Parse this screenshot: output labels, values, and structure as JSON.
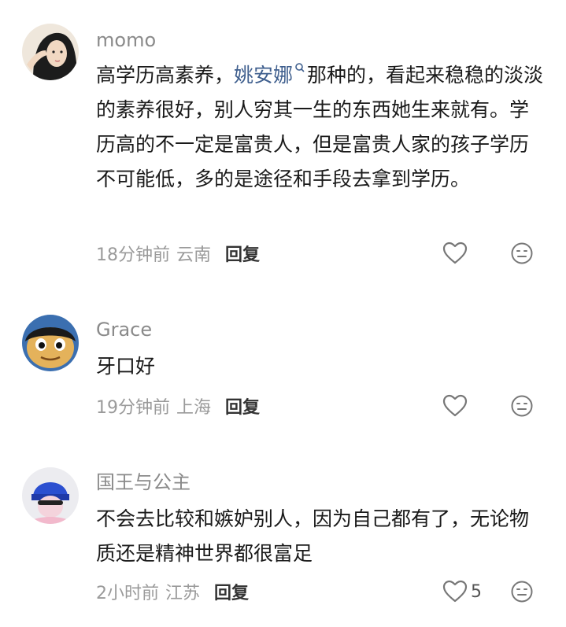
{
  "comments": [
    {
      "username": "momo",
      "text_before": "高学历高素养，",
      "mention": "姚安娜",
      "text_after": "那种的，看起来稳稳的淡淡的素养很好，别人穷其一生的东西她生来就有。学历高的不一定是富贵人，但是富贵人家的孩子学历不可能低，多的是途径和手段去拿到学历。",
      "time": "18分钟前",
      "location": "云南",
      "reply_label": "回复",
      "likes": ""
    },
    {
      "username": "Grace",
      "text_before": "牙口好",
      "mention": "",
      "text_after": "",
      "time": "19分钟前",
      "location": "上海",
      "reply_label": "回复",
      "likes": ""
    },
    {
      "username": "国王与公主",
      "text_before": "不会去比较和嫉妒别人，因为自己都有了，无论物质还是精神世界都很富足",
      "mention": "",
      "text_after": "",
      "time": "2小时前",
      "location": "江苏",
      "reply_label": "回复",
      "likes": "5"
    }
  ],
  "icons": {
    "like": "heart-outline-icon",
    "react": "neutral-face-icon",
    "mention": "search-magnifier-icon"
  },
  "colors": {
    "mention": "#3f5f8e",
    "meta": "#9a9a9a",
    "username": "#8a8a8a"
  }
}
